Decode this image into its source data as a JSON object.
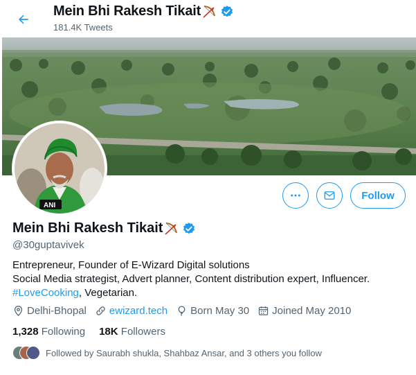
{
  "header": {
    "title": "Mein Bhi Rakesh Tikait",
    "tweet_count": "181.4K Tweets"
  },
  "profile": {
    "name": "Mein Bhi Rakesh Tikait",
    "handle": "@30guptavivek",
    "bio_line1": "Entrepreneur, Founder of E-Wizard Digital solutions",
    "bio_line2": "Social Media strategist, Advert planner, Content distribution expert, Influencer.",
    "bio_hashtag": "#LoveCooking",
    "bio_rest": ", Vegetarian.",
    "location": "Delhi-Bhopal",
    "website": "ewizard.tech",
    "born": "Born May 30",
    "joined": "Joined May 2010"
  },
  "stats": {
    "following_count": "1,328",
    "following_label": "Following",
    "followers_count": "18K",
    "followers_label": "Followers"
  },
  "followed_by": "Followed by Saurabh shukla, Shahbaz Ansar, and 3 others you follow",
  "buttons": {
    "follow_label": "Follow"
  },
  "avatar_badge": "ANI",
  "colors": {
    "accent": "#1d9bf0",
    "secondary_text": "#536471",
    "primary_text": "#0f1419",
    "verified": "#1d9bf0"
  },
  "icons": [
    "back-arrow-icon",
    "bow-arrow-emoji",
    "verified-badge-icon",
    "more-icon",
    "message-icon",
    "location-icon",
    "link-icon",
    "birthday-icon",
    "calendar-icon"
  ]
}
